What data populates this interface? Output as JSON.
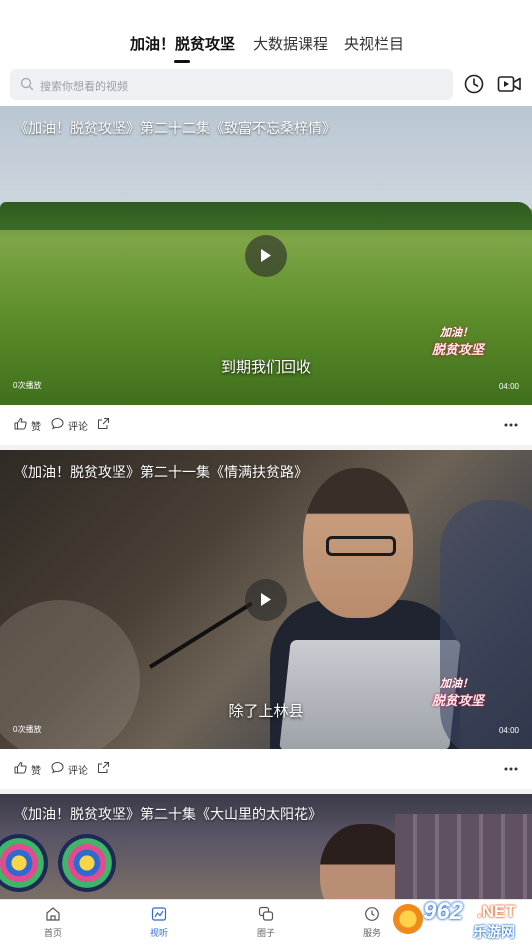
{
  "header": {
    "tabs": [
      {
        "label": "加油！脱贫攻坚",
        "active": true
      },
      {
        "label": "大数据课程",
        "active": false
      },
      {
        "label": "央视栏目",
        "active": false
      }
    ]
  },
  "search": {
    "placeholder": "搜索你想看的视频",
    "icons": [
      "search-icon",
      "history-icon",
      "video-record-icon"
    ]
  },
  "feed": [
    {
      "title": "《加油！脱贫攻坚》第二十二集《致富不忘桑梓情》",
      "subtitle": "到期我们回收",
      "views": "0次播放",
      "duration": "04:00",
      "logo_line1": "加油！",
      "logo_line2": "脱贫攻坚",
      "like": "赞",
      "comment": "评论"
    },
    {
      "title": "《加油！脱贫攻坚》第二十一集《情满扶贫路》",
      "subtitle": "除了上林县",
      "views": "0次播放",
      "duration": "04:00",
      "logo_line1": "加油！",
      "logo_line2": "脱贫攻坚",
      "like": "赞",
      "comment": "评论"
    },
    {
      "title": "《加油！脱贫攻坚》第二十集《大山里的太阳花》"
    }
  ],
  "bottom_nav": [
    {
      "label": "首页",
      "icon": "home-icon",
      "active": false
    },
    {
      "label": "视听",
      "icon": "media-icon",
      "active": true
    },
    {
      "label": "圈子",
      "icon": "circle-chat-icon",
      "active": false
    },
    {
      "label": "服务",
      "icon": "service-clock-icon",
      "active": false
    }
  ],
  "watermark": {
    "number": "962",
    "suffix": ".NET",
    "site": "乐游网"
  },
  "colors": {
    "accent": "#2f6bd8",
    "text": "#333333",
    "search_bg": "#eef0f3"
  }
}
